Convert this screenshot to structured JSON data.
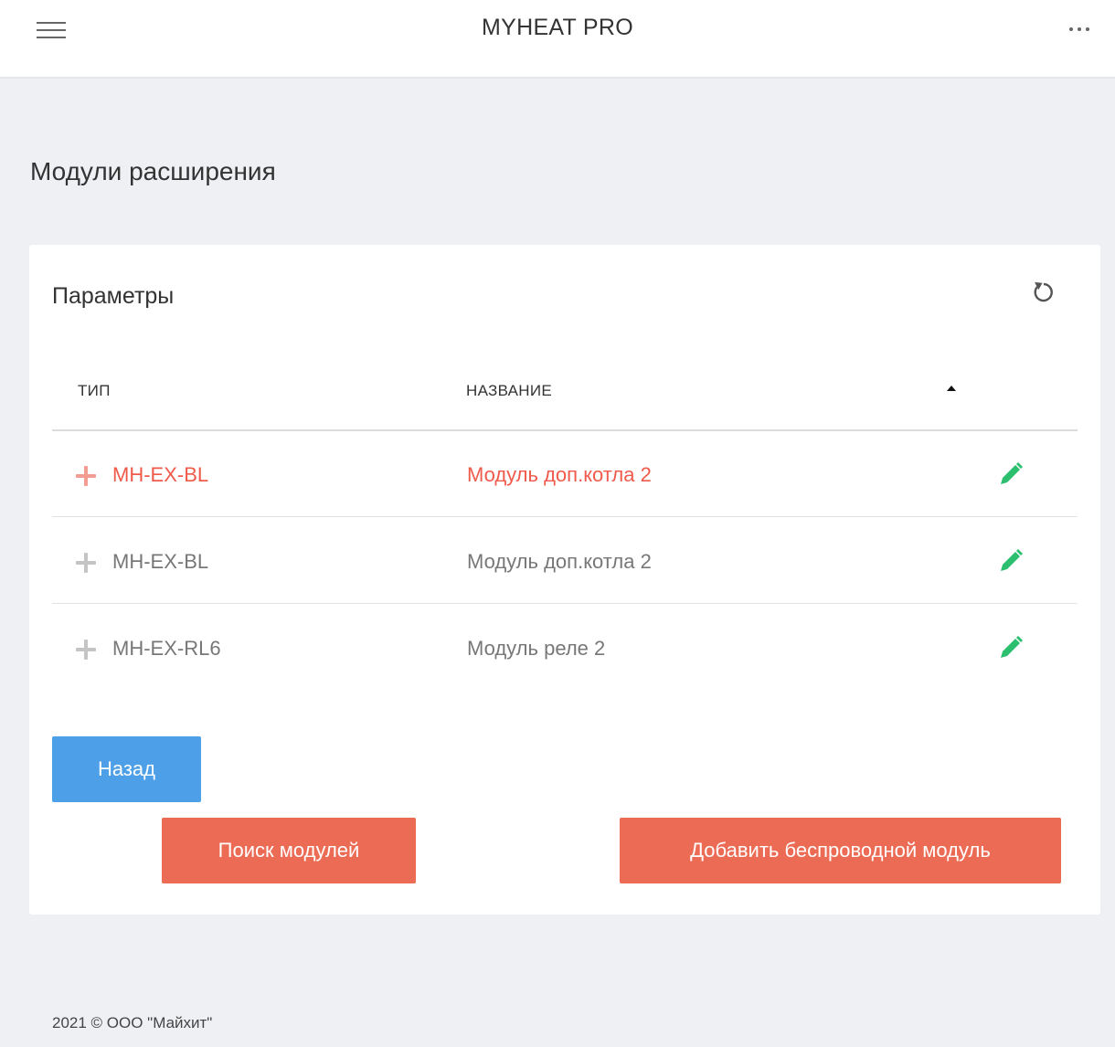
{
  "header": {
    "title": "MYHEAT PRO",
    "menu_icon": "hamburger-icon",
    "more_icon": "more-dots-icon"
  },
  "page": {
    "title": "Модули расширения"
  },
  "card": {
    "title": "Параметры",
    "refresh_icon": "refresh-icon",
    "columns": [
      "ТИП",
      "НАЗВАНИЕ"
    ],
    "sort_icon": "sort-asc-icon",
    "rows": [
      {
        "type": "MH-EX-BL",
        "name": "Модуль доп.котла 2",
        "state": "highlighted"
      },
      {
        "type": "MH-EX-BL",
        "name": "Модуль доп.котла 2",
        "state": "normal"
      },
      {
        "type": "MH-EX-RL6",
        "name": "Модуль реле 2",
        "state": "normal"
      }
    ]
  },
  "buttons": {
    "back": "Назад",
    "search": "Поиск модулей",
    "add_wireless": "Добавить беспроводной модуль"
  },
  "footer": {
    "text": "2021 © ООО \"Майхит\""
  },
  "colors": {
    "accent_red": "#ec6b55",
    "accent_blue": "#4d9fe8",
    "edit_green": "#2bbf6f",
    "background": "#eef0f4"
  }
}
